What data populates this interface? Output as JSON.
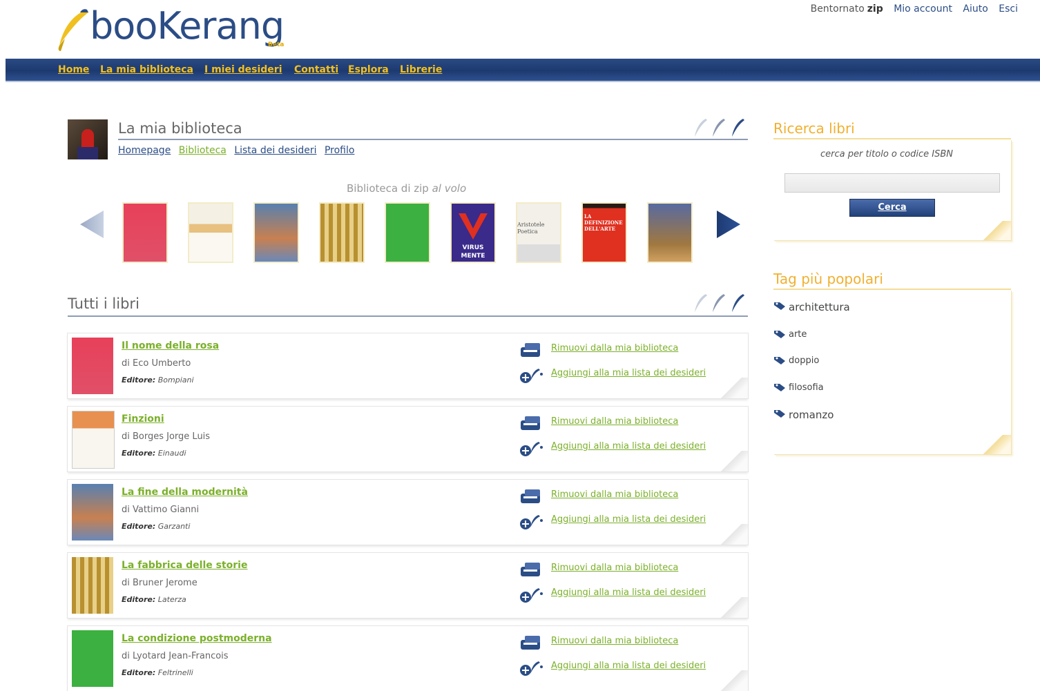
{
  "app": {
    "logo_text": "booKerang",
    "logo_badge": "Beta"
  },
  "toplinks": {
    "welcome": "Bentornato",
    "user": "zip",
    "account": "Mio account",
    "help": "Aiuto",
    "logout": "Esci"
  },
  "nav": [
    "Home",
    "La mia biblioteca",
    "I miei desideri",
    "Contatti",
    "Esplora",
    "Librerie"
  ],
  "profile": {
    "title": "La mia biblioteca",
    "subnav": [
      "Homepage",
      "Biblioteca",
      "Lista dei desideri",
      "Profilo"
    ],
    "active_subnav": "Biblioteca"
  },
  "carousel": {
    "caption_prefix": "Biblioteca di zip",
    "caption_suffix": "al volo",
    "cover_text": {
      "virus_line1": "VIRUS",
      "virus_line2": "MENTE",
      "poetica": "Aristotele Poetica",
      "definizione": "LA DEFINIZIONE DELL'ARTE"
    }
  },
  "all_books": {
    "title": "Tutti i libri",
    "publisher_label": "Editore:",
    "remove_label": "Rimuovi dalla mia biblioteca",
    "wishlist_label": "Aggiungi alla mia lista dei desideri",
    "items": [
      {
        "title": "Il nome della rosa",
        "author": "di Eco Umberto",
        "publisher": "Bompiani"
      },
      {
        "title": "Finzioni",
        "author": "di Borges Jorge Luis",
        "publisher": "Einaudi"
      },
      {
        "title": "La fine della modernità",
        "author": "di Vattimo Gianni",
        "publisher": "Garzanti"
      },
      {
        "title": "La fabbrica delle storie",
        "author": "di Bruner Jerome",
        "publisher": "Laterza"
      },
      {
        "title": "La condizione postmoderna",
        "author": "di Lyotard Jean-Francois",
        "publisher": "Feltrinelli"
      }
    ]
  },
  "search": {
    "title": "Ricerca libri",
    "hint": "cerca per titolo o codice ISBN",
    "input_value": "",
    "button": "Cerca"
  },
  "tags": {
    "title": "Tag più popolari",
    "items": [
      "architettura",
      "arte",
      "doppio",
      "filosofia",
      "romanzo"
    ]
  },
  "colors": {
    "nav_bg": "#1d3a70",
    "nav_text": "#f3c01f",
    "link_green": "#7bb02a",
    "side_title": "#f0b030"
  }
}
